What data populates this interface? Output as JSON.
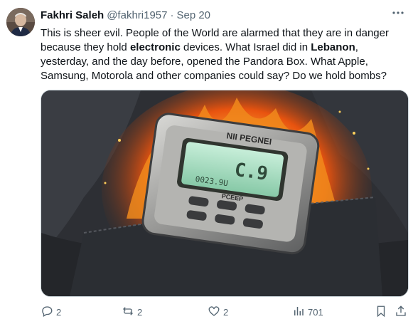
{
  "tweet": {
    "author_name": "Fakhri Saleh",
    "handle": "@fakhri1957",
    "separator": "·",
    "date": "Sep 20",
    "text_parts": [
      "This is sheer evil. People of the World are alarmed that they are in danger because they hold ",
      "electronic",
      " devices. What Israel did in ",
      "Lebanon",
      ", yesterday, and the day before, opened the Pandora Box. What Apple, Samsung, Motorola and other companies could say? Do we hold bombs?"
    ],
    "image": {
      "device_label_top": "NII PEGNEI",
      "screen_big": "C.9",
      "screen_small": "0023.9U",
      "device_label_mid": "PCEEP"
    },
    "stats": {
      "replies": "2",
      "reposts": "2",
      "likes": "2",
      "views": "701"
    }
  },
  "icons": {
    "more": "more-icon",
    "reply": "reply-icon",
    "repost": "repost-icon",
    "like": "like-icon",
    "views": "views-icon",
    "bookmark": "bookmark-icon",
    "share": "share-icon"
  }
}
